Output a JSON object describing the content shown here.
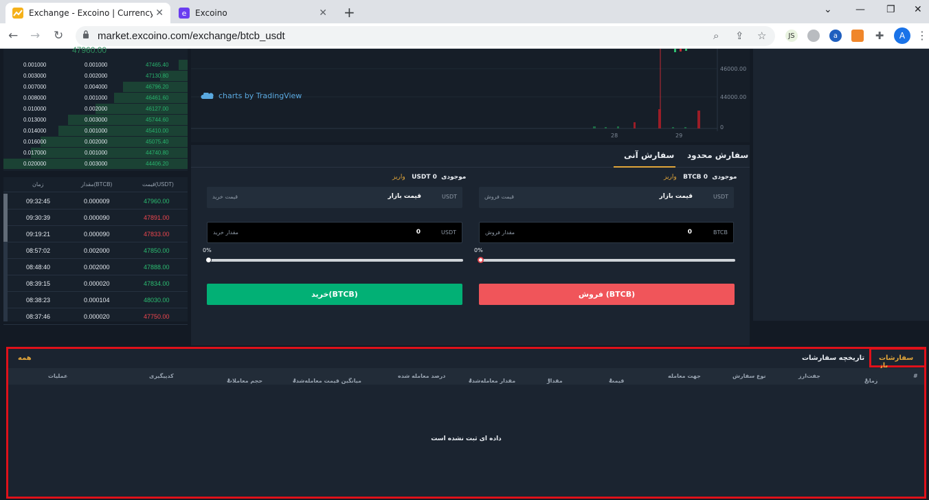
{
  "browser": {
    "tabs": [
      {
        "title": "Exchange - Excoino | Currency st",
        "active": true
      },
      {
        "title": "Excoino",
        "active": false
      }
    ],
    "url": "market.excoino.com/exchange/btcb_usdt",
    "profile_initial": "A",
    "ext_js_label": "JS",
    "ext_a_label": "a"
  },
  "orderbook": {
    "top_price": "47960.00",
    "rows": [
      {
        "amount": "0.001000",
        "total": "0.001000",
        "price": "47465.40"
      },
      {
        "amount": "0.003000",
        "total": "0.002000",
        "price": "47130.80"
      },
      {
        "amount": "0.007000",
        "total": "0.004000",
        "price": "46796.20"
      },
      {
        "amount": "0.008000",
        "total": "0.001000",
        "price": "46461.60"
      },
      {
        "amount": "0.010000",
        "total": "0.002000",
        "price": "46127.00"
      },
      {
        "amount": "0.013000",
        "total": "0.003000",
        "price": "45744.60"
      },
      {
        "amount": "0.014000",
        "total": "0.001000",
        "price": "45410.00"
      },
      {
        "amount": "0.016000",
        "total": "0.002000",
        "price": "45075.40"
      },
      {
        "amount": "0.017000",
        "total": "0.001000",
        "price": "44740.80"
      },
      {
        "amount": "0.020000",
        "total": "0.003000",
        "price": "44406.20"
      }
    ],
    "fill_fractions": [
      0.05,
      0.15,
      0.35,
      0.4,
      0.5,
      0.65,
      0.7,
      0.8,
      0.85,
      1.0
    ]
  },
  "trades": {
    "headers": {
      "price": "قیمت(USDT)",
      "amount": "مقدار(BTCB)",
      "time": "زمان"
    },
    "rows": [
      {
        "time": "09:32:45",
        "amount": "0.000009",
        "price": "47960.00",
        "dir": "up"
      },
      {
        "time": "09:30:39",
        "amount": "0.000090",
        "price": "47891.00",
        "dir": "down"
      },
      {
        "time": "09:19:21",
        "amount": "0.000090",
        "price": "47833.00",
        "dir": "down"
      },
      {
        "time": "08:57:02",
        "amount": "0.002000",
        "price": "47850.00",
        "dir": "up"
      },
      {
        "time": "08:48:40",
        "amount": "0.002000",
        "price": "47888.00",
        "dir": "up"
      },
      {
        "time": "08:39:15",
        "amount": "0.000020",
        "price": "47834.00",
        "dir": "up"
      },
      {
        "time": "08:38:23",
        "amount": "0.000104",
        "price": "48030.00",
        "dir": "up"
      },
      {
        "time": "08:37:46",
        "amount": "0.000020",
        "price": "47750.00",
        "dir": "down"
      }
    ]
  },
  "chart": {
    "attribution": "charts by TradingView",
    "price_labels": [
      "46000.00",
      "44000.00",
      "0"
    ],
    "x_labels": [
      "28",
      "29"
    ]
  },
  "form": {
    "tab_limit": "سفارش محدود",
    "tab_market": "سفارش آنی",
    "sell": {
      "balance_label": "موجودی",
      "balance_value": "0",
      "balance_unit": "BTCB",
      "deposit": "واریز",
      "price_label": "قیمت فروش",
      "price_value": "قیمت بازار",
      "price_unit": "USDT",
      "amount_label": "مقدار فروش",
      "amount_value": "0",
      "amount_unit": "BTCB",
      "percent": "0%",
      "button": "فروش (BTCB)"
    },
    "buy": {
      "balance_label": "موجودی",
      "balance_value": "0",
      "balance_unit": "USDT",
      "deposit": "واریز",
      "price_label": "قیمت خرید",
      "price_value": "قیمت بازار",
      "price_unit": "USDT",
      "amount_label": "مقدار خرید",
      "amount_value": "0",
      "amount_unit": "USDT",
      "percent": "0%",
      "button": "خرید(BTCB)"
    },
    "colors": {
      "buy": "#02b075",
      "sell": "#f0555a",
      "accent": "#e2a63a"
    }
  },
  "orders": {
    "tab_open": "سفارشات باز",
    "tab_history": "تاریخچه سفارشات",
    "filter_all": "همه",
    "columns": {
      "index": "#",
      "time": "زمان",
      "pair": "جفت‌ارز",
      "order_type": "نوع سفارش",
      "direction": "جهت معامله",
      "price": "قیمت",
      "amount": "مقدار",
      "filled": "مقدار معامله‌شده",
      "fill_percent": "درصد معامله شده",
      "avg_price": "میانگین قیمت معامله‌شده",
      "volume": "حجم معاملات",
      "ref_code": "کدپیگیری",
      "actions": "عملیات"
    },
    "empty_message": "داده ای ثبت نشده است"
  }
}
